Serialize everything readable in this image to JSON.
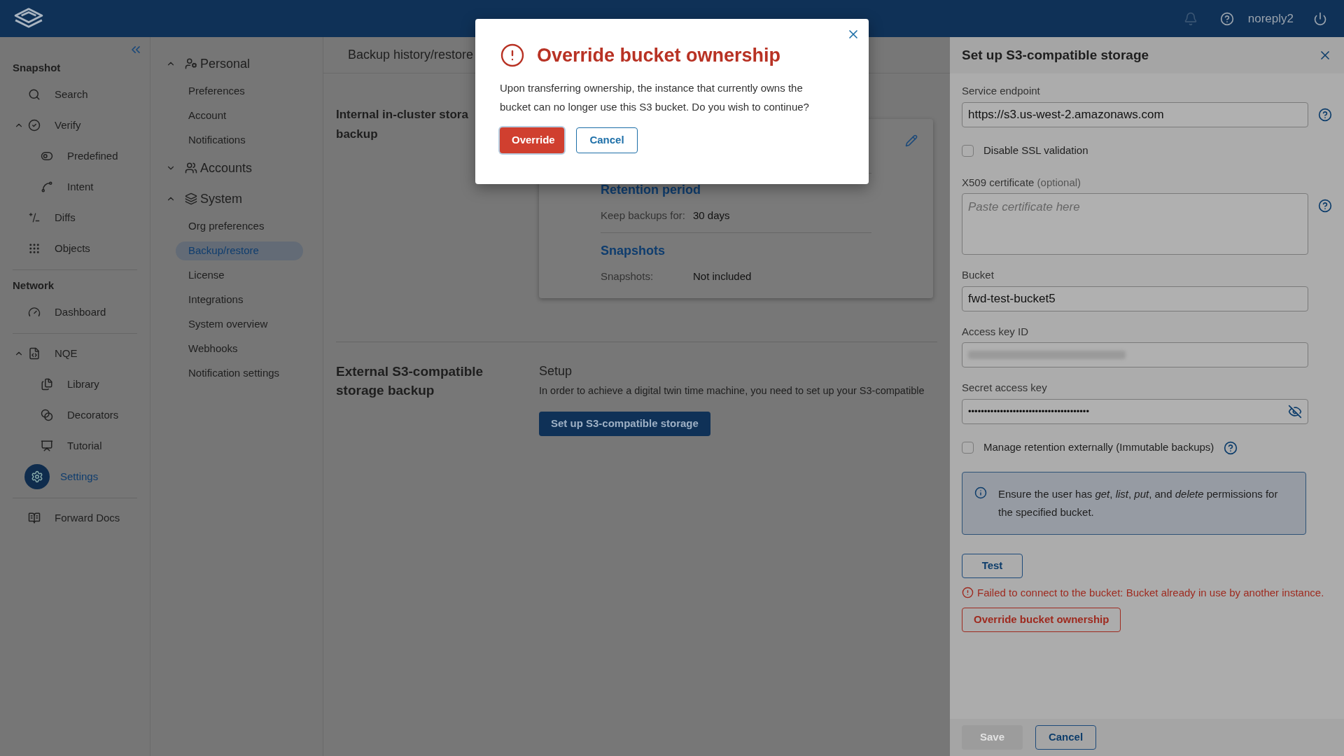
{
  "top_bar": {
    "username": "noreply2"
  },
  "nav": {
    "sections": [
      {
        "title": "Snapshot",
        "items": [
          {
            "label": "Search",
            "selected": false
          },
          {
            "label": "Verify",
            "selected": false,
            "expanded": true,
            "children": [
              {
                "label": "Predefined",
                "selected": false
              },
              {
                "label": "Intent",
                "selected": false
              }
            ]
          },
          {
            "label": "Diffs",
            "selected": false
          },
          {
            "label": "Objects",
            "selected": false
          }
        ]
      },
      {
        "title": "Network",
        "items": [
          {
            "label": "Dashboard",
            "selected": false
          }
        ]
      },
      {
        "items": [
          {
            "label": "NQE",
            "selected": false,
            "expanded": true,
            "children": [
              {
                "label": "Library",
                "selected": false
              },
              {
                "label": "Decorators",
                "selected": false
              },
              {
                "label": "Tutorial",
                "selected": false
              }
            ]
          },
          {
            "label": "Settings",
            "selected": true
          }
        ]
      },
      {
        "items": [
          {
            "label": "Forward Docs",
            "selected": false
          }
        ]
      }
    ]
  },
  "settings_nav": [
    {
      "label": "Personal",
      "expanded": true,
      "children": [
        {
          "label": "Preferences",
          "selected": false
        },
        {
          "label": "Account",
          "selected": false
        },
        {
          "label": "Notifications",
          "selected": false
        }
      ]
    },
    {
      "label": "Accounts",
      "expanded": false
    },
    {
      "label": "System",
      "expanded": true,
      "children": [
        {
          "label": "Org preferences",
          "selected": false
        },
        {
          "label": "Backup/restore",
          "selected": true
        },
        {
          "label": "License",
          "selected": false
        },
        {
          "label": "Integrations",
          "selected": false
        },
        {
          "label": "System overview",
          "selected": false
        },
        {
          "label": "Webhooks",
          "selected": false
        },
        {
          "label": "Notification settings",
          "selected": false
        }
      ]
    }
  ],
  "main": {
    "tab": "Backup history/restore",
    "internal": {
      "title_lines": [
        "Internal in-cluster stora",
        "backup"
      ],
      "card": [
        {
          "heading": "Retention period",
          "rows": [
            {
              "label": "Keep backups for:",
              "value": "30 days"
            }
          ]
        },
        {
          "heading": "Snapshots",
          "rows": [
            {
              "label": "Snapshots:",
              "value": "Not included"
            }
          ]
        }
      ]
    },
    "external": {
      "title": "External S3-compatible storage backup",
      "heading": "Setup",
      "text": "In order to achieve a digital twin time machine, you need to set up your S3-compatible",
      "button": "Set up S3-compatible storage"
    }
  },
  "side_panel": {
    "title": "Set up S3-compatible storage",
    "fields": [
      {
        "kind": "text",
        "label": "Service endpoint",
        "value": "https://s3.us-west-2.amazonaws.com",
        "help": true
      },
      {
        "kind": "checkbox",
        "label": "Disable SSL validation",
        "checked": false,
        "help": false
      },
      {
        "kind": "textarea",
        "label": "X509 certificate",
        "note": "(optional)",
        "placeholder": "Paste certificate here",
        "help": true
      },
      {
        "kind": "text",
        "label": "Bucket",
        "value": "fwd-test-bucket5",
        "help": false
      },
      {
        "kind": "redacted",
        "label": "Access key ID",
        "help": false
      },
      {
        "kind": "password",
        "label": "Secret access key",
        "value": "••••••••••••••••••••••••••••••••••••••",
        "help": false
      },
      {
        "kind": "checkbox",
        "label": "Manage retention externally (Immutable backups)",
        "checked": false,
        "help": true
      }
    ],
    "info": "Ensure the user has *get*, *list*, *put*, and *delete* permissions for the specified bucket.",
    "test_button": "Test",
    "error": "Failed to connect to the bucket: Bucket already in use by another instance.",
    "override_button": "Override bucket ownership",
    "footer_buttons": [
      {
        "label": "Save",
        "disabled": true
      },
      {
        "label": "Cancel",
        "disabled": false
      }
    ]
  },
  "modal": {
    "title": "Override bucket ownership",
    "body": "Upon transferring ownership, the instance that currently owns the bucket can no longer use this S3 bucket. Do you wish to continue?",
    "buttons": [
      {
        "label": "Override",
        "kind": "danger"
      },
      {
        "label": "Cancel",
        "kind": "outline"
      }
    ]
  }
}
